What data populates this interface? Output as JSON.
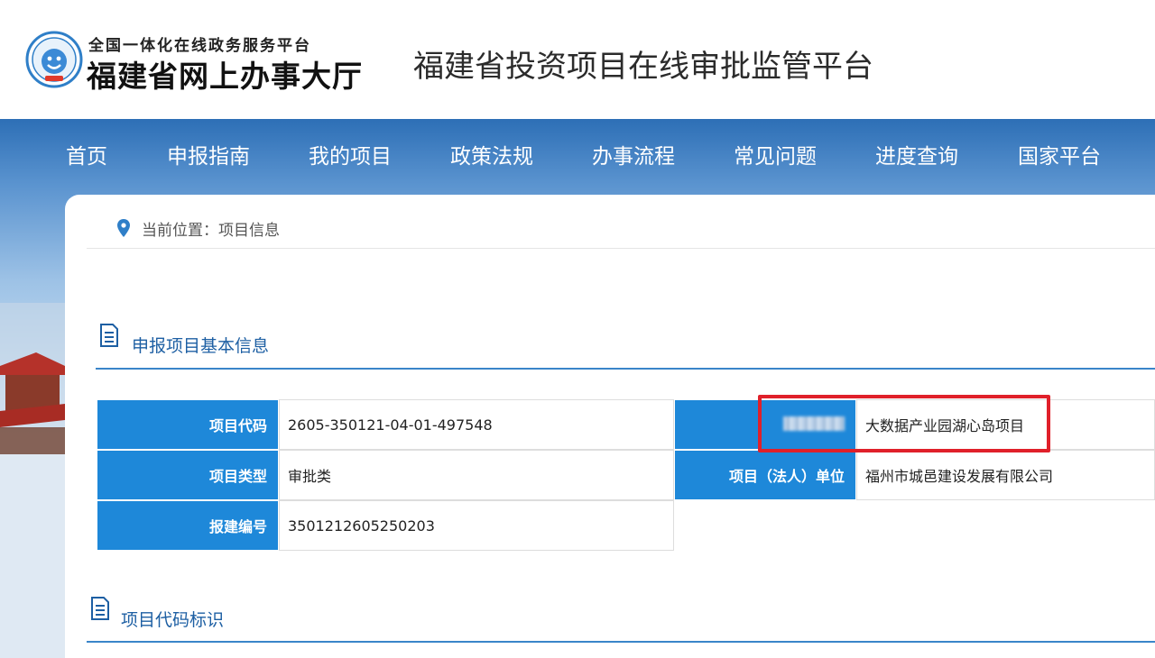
{
  "header": {
    "logo_subtitle": "全国一体化在线政务服务平台",
    "logo_title": "福建省网上办事大厅",
    "platform_title": "福建省投资项目在线审批监管平台"
  },
  "nav": {
    "items": [
      {
        "label": "首页"
      },
      {
        "label": "申报指南"
      },
      {
        "label": "我的项目"
      },
      {
        "label": "政策法规"
      },
      {
        "label": "办事流程"
      },
      {
        "label": "常见问题"
      },
      {
        "label": "进度查询"
      },
      {
        "label": "国家平台"
      }
    ]
  },
  "breadcrumb": {
    "text": "当前位置：项目信息"
  },
  "section_basic": {
    "title": "申报项目基本信息",
    "rows": [
      {
        "label": "项目代码",
        "value": "2605-350121-04-01-497548"
      },
      {
        "label": "项目类型",
        "value": "审批类"
      },
      {
        "label": "报建编号",
        "value": "3501212605250203"
      }
    ],
    "right_rows": [
      {
        "label": "",
        "value": "大数据产业园湖心岛项目"
      },
      {
        "label": "项目（法人）单位",
        "value": "福州市城邑建设发展有限公司"
      }
    ]
  },
  "section_code": {
    "title": "项目代码标识"
  },
  "colors": {
    "nav_blue": "#2d6fb6",
    "label_blue": "#1e88d9",
    "section_text": "#1d5fa3",
    "highlight_red": "#e0202a"
  }
}
